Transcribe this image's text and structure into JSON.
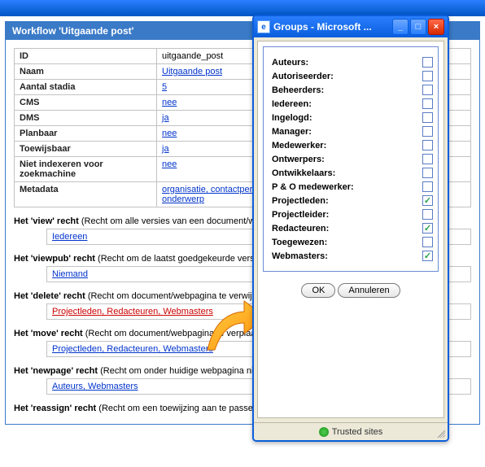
{
  "panel": {
    "title": "Workflow 'Uitgaande post'",
    "fields": {
      "id": {
        "label": "ID",
        "value": "uitgaande_post"
      },
      "naam": {
        "label": "Naam",
        "value": "Uitgaande post"
      },
      "stadia": {
        "label": "Aantal stadia",
        "value": "5"
      },
      "cms": {
        "label": "CMS",
        "value": "nee"
      },
      "dms": {
        "label": "DMS",
        "value": "ja"
      },
      "planbaar": {
        "label": "Planbaar",
        "value": "nee"
      },
      "toewijsbaar": {
        "label": "Toewijsbaar",
        "value": "ja"
      },
      "niet_index": {
        "label": "Niet indexeren voor zoekmachine",
        "value": "nee"
      },
      "metadata": {
        "label": "Metadata",
        "value": "organisatie, contactpersoon, behandelaar, kenmerk, auteur, projectcode, onderwerp"
      }
    }
  },
  "rights": {
    "view": {
      "title_bold": "Het 'view' recht",
      "title_rest": " (Recht om alle versies van een document/webpagina te bekijken)",
      "groups": "Iedereen"
    },
    "viewpub": {
      "title_bold": "Het 'viewpub' recht",
      "title_rest": " (Recht om de laatst goedgekeurde versie te bekijken)",
      "groups": "Niemand"
    },
    "delete": {
      "title_bold": "Het 'delete' recht",
      "title_rest": " (Recht om document/webpagina te verwijderen)",
      "groups": "Projectleden, Redacteuren, Webmasters"
    },
    "move": {
      "title_bold": "Het 'move' recht",
      "title_rest": " (Recht om document/webpagina te verplaatsen)",
      "groups": "Projectleden, Redacteuren, Webmasters"
    },
    "newpage": {
      "title_bold": "Het 'newpage' recht",
      "title_rest": " (Recht om onder huidige webpagina nieuwe aan te maken)",
      "groups": "Auteurs, Webmasters"
    },
    "reassign": {
      "title_bold": "Het 'reassign' recht",
      "title_rest": " (Recht om een toewijzing aan te passen (heralloceren))"
    }
  },
  "popup": {
    "title": "Groups - Microsoft ...",
    "buttons": {
      "ok": "OK",
      "cancel": "Annuleren"
    },
    "status": "Trusted sites",
    "groups": [
      {
        "label": "Auteurs:",
        "checked": false
      },
      {
        "label": "Autoriseerder:",
        "checked": false
      },
      {
        "label": "Beheerders:",
        "checked": false
      },
      {
        "label": "Iedereen:",
        "checked": false
      },
      {
        "label": "Ingelogd:",
        "checked": false
      },
      {
        "label": "Manager:",
        "checked": false
      },
      {
        "label": "Medewerker:",
        "checked": false
      },
      {
        "label": "Ontwerpers:",
        "checked": false
      },
      {
        "label": "Ontwikkelaars:",
        "checked": false
      },
      {
        "label": "P & O medewerker:",
        "checked": false
      },
      {
        "label": "Projectleden:",
        "checked": true
      },
      {
        "label": "Projectleider:",
        "checked": false
      },
      {
        "label": "Redacteuren:",
        "checked": true
      },
      {
        "label": "Toegewezen:",
        "checked": false
      },
      {
        "label": "Webmasters:",
        "checked": true
      }
    ]
  }
}
